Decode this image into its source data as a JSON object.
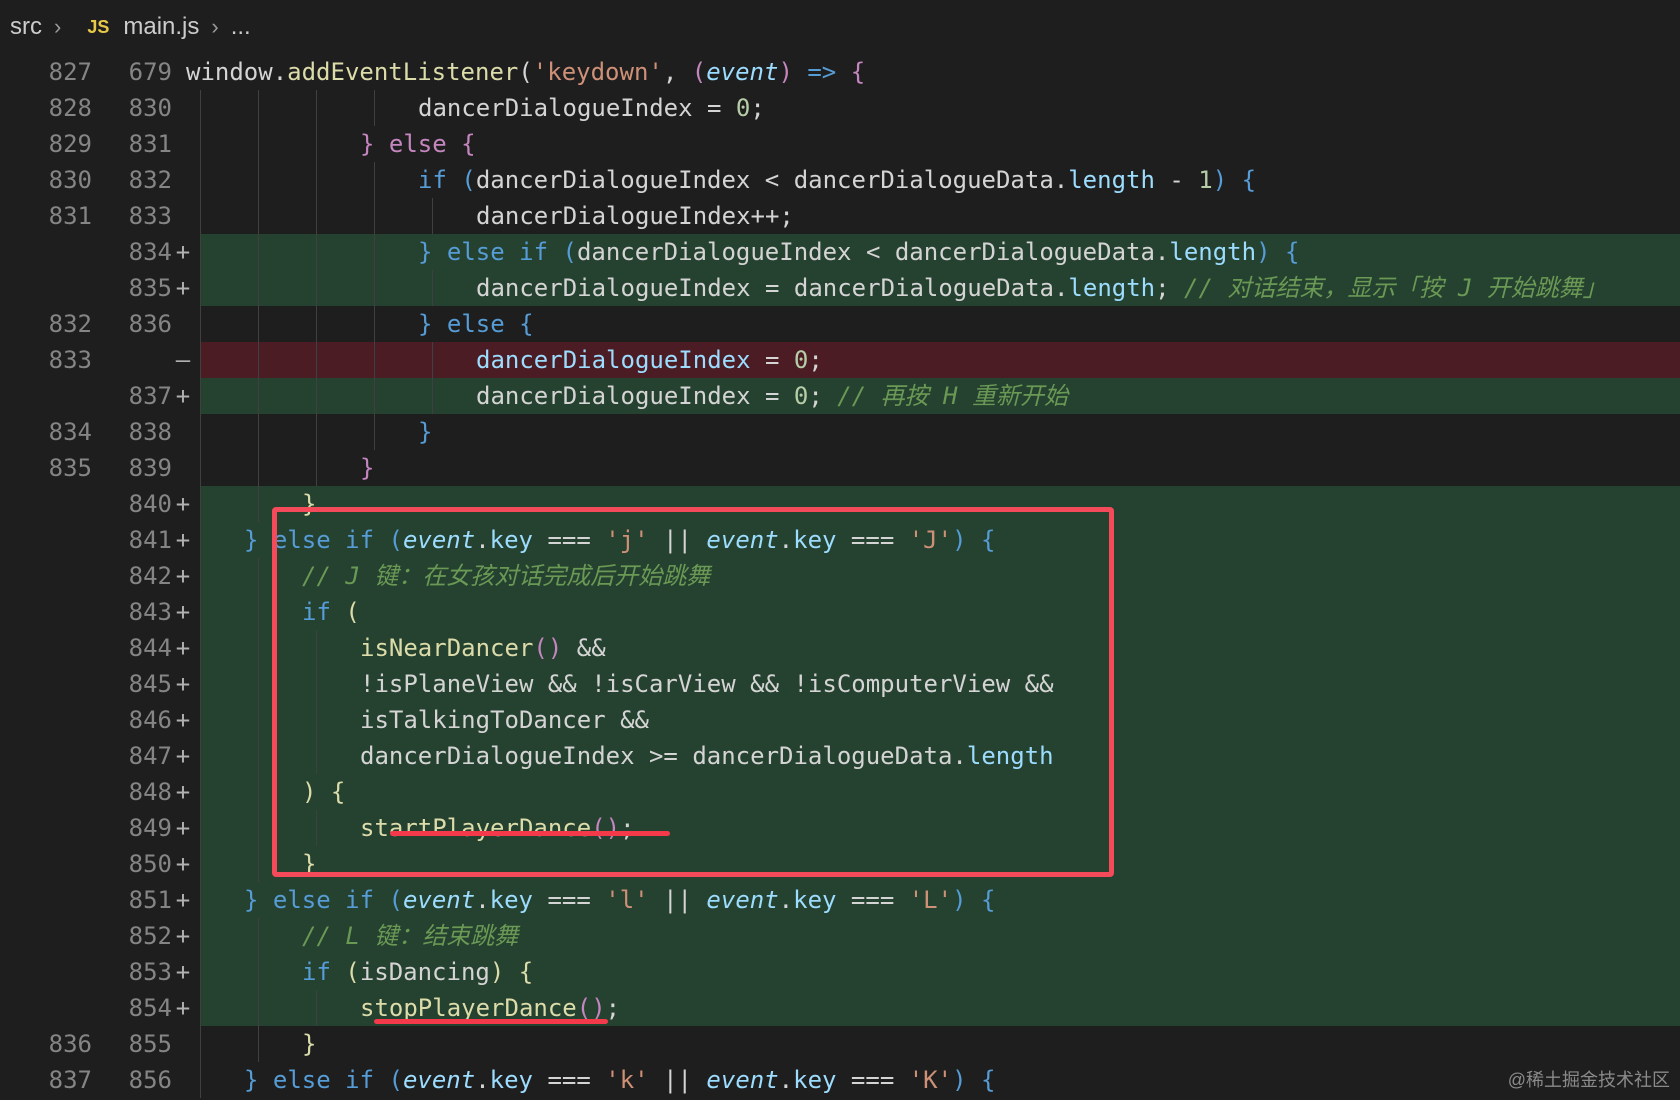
{
  "breadcrumb": {
    "folder": "src",
    "file_icon": "JS",
    "file": "main.js",
    "more": "..."
  },
  "colors": {
    "added_bg": "#25412f",
    "removed_bg": "#4b1c24",
    "highlight_box": "#f44a5a",
    "keyword": "#c586c0",
    "control": "#569cd6",
    "function": "#dcdcaa",
    "property": "#9cdcfe",
    "string": "#ce9178",
    "comment": "#6a9955",
    "number": "#b5cea8"
  },
  "lines": [
    {
      "old": "827",
      "new": "679",
      "marker": "",
      "type": "context",
      "indent": 0,
      "tokens": [
        [
          "window.",
          "#d4d4d4"
        ],
        [
          "addEventListener",
          "#dcdcaa"
        ],
        [
          "(",
          "#d4d4d4"
        ],
        [
          "'keydown'",
          "#ce9178"
        ],
        [
          ", ",
          "#d4d4d4"
        ],
        [
          "(",
          "#c586c0"
        ],
        [
          "event",
          "#9cdcfe"
        ],
        [
          ") ",
          "#c586c0"
        ],
        [
          "=> ",
          "#569cd6"
        ],
        [
          "{",
          "#c586c0"
        ]
      ]
    },
    {
      "old": "828",
      "new": "830",
      "marker": "",
      "type": "context",
      "indent": 8,
      "tokens": [
        [
          "dancerDialogueIndex ",
          "#d4d4d4"
        ],
        [
          "= ",
          "#d4d4d4"
        ],
        [
          "0",
          "#b5cea8"
        ],
        [
          ";",
          "#d4d4d4"
        ]
      ]
    },
    {
      "old": "829",
      "new": "831",
      "marker": "",
      "type": "context",
      "indent": 6,
      "tokens": [
        [
          "} ",
          "#c586c0"
        ],
        [
          "else ",
          "#c586c0"
        ],
        [
          "{",
          "#c586c0"
        ]
      ]
    },
    {
      "old": "830",
      "new": "832",
      "marker": "",
      "type": "context",
      "indent": 8,
      "tokens": [
        [
          "if ",
          "#569cd6"
        ],
        [
          "(",
          "#569cd6"
        ],
        [
          "dancerDialogueIndex < dancerDialogueData.",
          "#d4d4d4"
        ],
        [
          "length",
          "#9cdcfe"
        ],
        [
          " - ",
          "#d4d4d4"
        ],
        [
          "1",
          "#b5cea8"
        ],
        [
          ") ",
          "#569cd6"
        ],
        [
          "{",
          "#569cd6"
        ]
      ]
    },
    {
      "old": "831",
      "new": "833",
      "marker": "",
      "type": "context",
      "indent": 10,
      "tokens": [
        [
          "dancerDialogueIndex++;",
          "#d4d4d4"
        ]
      ]
    },
    {
      "old": "",
      "new": "834",
      "marker": "+",
      "type": "added",
      "indent": 8,
      "tokens": [
        [
          "} ",
          "#569cd6"
        ],
        [
          "else if ",
          "#569cd6"
        ],
        [
          "(",
          "#569cd6"
        ],
        [
          "dancerDialogueIndex < dancerDialogueData.",
          "#d4d4d4"
        ],
        [
          "length",
          "#9cdcfe"
        ],
        [
          ") ",
          "#569cd6"
        ],
        [
          "{",
          "#569cd6"
        ]
      ]
    },
    {
      "old": "",
      "new": "835",
      "marker": "+",
      "type": "added",
      "indent": 10,
      "tokens": [
        [
          "dancerDialogueIndex = dancerDialogueData.",
          "#d4d4d4"
        ],
        [
          "length",
          "#9cdcfe"
        ],
        [
          "; ",
          "#d4d4d4"
        ],
        [
          "// 对话结束，显示「按 J 开始跳舞」",
          "#6a9955"
        ]
      ]
    },
    {
      "old": "832",
      "new": "836",
      "marker": "",
      "type": "context",
      "indent": 8,
      "tokens": [
        [
          "} ",
          "#569cd6"
        ],
        [
          "else ",
          "#569cd6"
        ],
        [
          "{",
          "#569cd6"
        ]
      ]
    },
    {
      "old": "833",
      "new": "",
      "marker": "—",
      "type": "removed",
      "indent": 10,
      "tokens": [
        [
          "dancerDialogueIndex",
          "#9cdcfe"
        ],
        [
          " = ",
          "#d4d4d4"
        ],
        [
          "0",
          "#b5cea8"
        ],
        [
          ";",
          "#d4d4d4"
        ]
      ]
    },
    {
      "old": "",
      "new": "837",
      "marker": "+",
      "type": "added",
      "indent": 10,
      "tokens": [
        [
          "dancerDialogueIndex = ",
          "#d4d4d4"
        ],
        [
          "0",
          "#b5cea8"
        ],
        [
          "; ",
          "#d4d4d4"
        ],
        [
          "// 再按 H 重新开始",
          "#6a9955"
        ]
      ]
    },
    {
      "old": "834",
      "new": "838",
      "marker": "",
      "type": "context",
      "indent": 8,
      "tokens": [
        [
          "}",
          "#569cd6"
        ]
      ]
    },
    {
      "old": "835",
      "new": "839",
      "marker": "",
      "type": "context",
      "indent": 6,
      "tokens": [
        [
          "}",
          "#c586c0"
        ]
      ]
    },
    {
      "old": "",
      "new": "840",
      "marker": "+",
      "type": "added",
      "indent": 4,
      "tokens": [
        [
          "}",
          "#dcdcaa"
        ]
      ]
    },
    {
      "old": "",
      "new": "841",
      "marker": "+",
      "type": "added",
      "indent": 2,
      "tokens": [
        [
          "} ",
          "#569cd6"
        ],
        [
          "else if ",
          "#569cd6"
        ],
        [
          "(",
          "#569cd6"
        ],
        [
          "event",
          "#9cdcfe"
        ],
        [
          ".",
          "#d4d4d4"
        ],
        [
          "key",
          "#9cdcfe"
        ],
        [
          " === ",
          "#d4d4d4"
        ],
        [
          "'j'",
          "#ce9178"
        ],
        [
          " || ",
          "#d4d4d4"
        ],
        [
          "event",
          "#9cdcfe"
        ],
        [
          ".",
          "#d4d4d4"
        ],
        [
          "key",
          "#9cdcfe"
        ],
        [
          " === ",
          "#d4d4d4"
        ],
        [
          "'J'",
          "#ce9178"
        ],
        [
          ") ",
          "#569cd6"
        ],
        [
          "{",
          "#569cd6"
        ]
      ]
    },
    {
      "old": "",
      "new": "842",
      "marker": "+",
      "type": "added",
      "indent": 4,
      "tokens": [
        [
          "// J 键：在女孩对话完成后开始跳舞",
          "#6a9955"
        ]
      ]
    },
    {
      "old": "",
      "new": "843",
      "marker": "+",
      "type": "added",
      "indent": 4,
      "tokens": [
        [
          "if ",
          "#569cd6"
        ],
        [
          "(",
          "#dcdcaa"
        ]
      ]
    },
    {
      "old": "",
      "new": "844",
      "marker": "+",
      "type": "added",
      "indent": 6,
      "tokens": [
        [
          "isNearDancer",
          "#dcdcaa"
        ],
        [
          "()",
          "#c586c0"
        ],
        [
          " &&",
          "#d4d4d4"
        ]
      ]
    },
    {
      "old": "",
      "new": "845",
      "marker": "+",
      "type": "added",
      "indent": 6,
      "tokens": [
        [
          "!isPlaneView && !isCarView && !isComputerView &&",
          "#d4d4d4"
        ]
      ]
    },
    {
      "old": "",
      "new": "846",
      "marker": "+",
      "type": "added",
      "indent": 6,
      "tokens": [
        [
          "isTalkingToDancer &&",
          "#d4d4d4"
        ]
      ]
    },
    {
      "old": "",
      "new": "847",
      "marker": "+",
      "type": "added",
      "indent": 6,
      "tokens": [
        [
          "dancerDialogueIndex >= dancerDialogueData.",
          "#d4d4d4"
        ],
        [
          "length",
          "#9cdcfe"
        ]
      ]
    },
    {
      "old": "",
      "new": "848",
      "marker": "+",
      "type": "added",
      "indent": 4,
      "tokens": [
        [
          ")",
          "#dcdcaa"
        ],
        [
          " {",
          "#dcdcaa"
        ]
      ]
    },
    {
      "old": "",
      "new": "849",
      "marker": "+",
      "type": "added",
      "indent": 6,
      "tokens": [
        [
          "startPlayerDance",
          "#dcdcaa"
        ],
        [
          "()",
          "#c586c0"
        ],
        [
          ";",
          "#d4d4d4"
        ]
      ]
    },
    {
      "old": "",
      "new": "850",
      "marker": "+",
      "type": "added",
      "indent": 4,
      "tokens": [
        [
          "}",
          "#dcdcaa"
        ]
      ]
    },
    {
      "old": "",
      "new": "851",
      "marker": "+",
      "type": "added",
      "indent": 2,
      "tokens": [
        [
          "} ",
          "#569cd6"
        ],
        [
          "else if ",
          "#569cd6"
        ],
        [
          "(",
          "#569cd6"
        ],
        [
          "event",
          "#9cdcfe"
        ],
        [
          ".",
          "#d4d4d4"
        ],
        [
          "key",
          "#9cdcfe"
        ],
        [
          " === ",
          "#d4d4d4"
        ],
        [
          "'l'",
          "#ce9178"
        ],
        [
          " || ",
          "#d4d4d4"
        ],
        [
          "event",
          "#9cdcfe"
        ],
        [
          ".",
          "#d4d4d4"
        ],
        [
          "key",
          "#9cdcfe"
        ],
        [
          " === ",
          "#d4d4d4"
        ],
        [
          "'L'",
          "#ce9178"
        ],
        [
          ") ",
          "#569cd6"
        ],
        [
          "{",
          "#569cd6"
        ]
      ]
    },
    {
      "old": "",
      "new": "852",
      "marker": "+",
      "type": "added",
      "indent": 4,
      "tokens": [
        [
          "// L 键：结束跳舞",
          "#6a9955"
        ]
      ]
    },
    {
      "old": "",
      "new": "853",
      "marker": "+",
      "type": "added",
      "indent": 4,
      "tokens": [
        [
          "if ",
          "#569cd6"
        ],
        [
          "(",
          "#dcdcaa"
        ],
        [
          "isDancing",
          "#d4d4d4"
        ],
        [
          ")",
          "#dcdcaa"
        ],
        [
          " {",
          "#dcdcaa"
        ]
      ]
    },
    {
      "old": "",
      "new": "854",
      "marker": "+",
      "type": "added",
      "indent": 6,
      "tokens": [
        [
          "stopPlayerDance",
          "#dcdcaa"
        ],
        [
          "()",
          "#c586c0"
        ],
        [
          ";",
          "#d4d4d4"
        ]
      ]
    },
    {
      "old": "836",
      "new": "855",
      "marker": "",
      "type": "context",
      "indent": 4,
      "tokens": [
        [
          "}",
          "#dcdcaa"
        ]
      ]
    },
    {
      "old": "837",
      "new": "856",
      "marker": "",
      "type": "context",
      "indent": 2,
      "tokens": [
        [
          "} ",
          "#569cd6"
        ],
        [
          "else if ",
          "#569cd6"
        ],
        [
          "(",
          "#569cd6"
        ],
        [
          "event",
          "#9cdcfe"
        ],
        [
          ".",
          "#d4d4d4"
        ],
        [
          "key",
          "#9cdcfe"
        ],
        [
          " === ",
          "#d4d4d4"
        ],
        [
          "'k'",
          "#ce9178"
        ],
        [
          " || ",
          "#d4d4d4"
        ],
        [
          "event",
          "#9cdcfe"
        ],
        [
          ".",
          "#d4d4d4"
        ],
        [
          "key",
          "#9cdcfe"
        ],
        [
          " === ",
          "#d4d4d4"
        ],
        [
          "'K'",
          "#ce9178"
        ],
        [
          ") ",
          "#569cd6"
        ],
        [
          "{",
          "#569cd6"
        ]
      ]
    }
  ],
  "watermark": "@稀土掘金技术社区"
}
